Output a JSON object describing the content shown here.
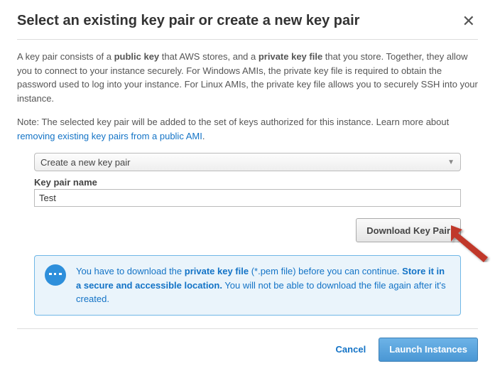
{
  "title": "Select an existing key pair or create a new key pair",
  "intro": {
    "t1": "A key pair consists of a ",
    "b1": "public key",
    "t2": " that AWS stores, and a ",
    "b2": "private key file",
    "t3": " that you store. Together, they allow you to connect to your instance securely. For Windows AMIs, the private key file is required to obtain the password used to log into your instance. For Linux AMIs, the private key file allows you to securely SSH into your instance."
  },
  "note": {
    "t1": "Note: The selected key pair will be added to the set of keys authorized for this instance. Learn more about ",
    "link": "removing existing key pairs from a public AMI",
    "t2": "."
  },
  "form": {
    "select_value": "Create a new key pair",
    "label": "Key pair name",
    "input_value": "Test",
    "download": "Download Key Pair"
  },
  "info": {
    "t1": "You have to download the ",
    "b1": "private key file",
    "t2": " (*.pem file) before you can continue. ",
    "b2": "Store it in a secure and accessible location.",
    "t3": " You will not be able to download the file again after it's created."
  },
  "footer": {
    "cancel": "Cancel",
    "launch": "Launch Instances"
  }
}
